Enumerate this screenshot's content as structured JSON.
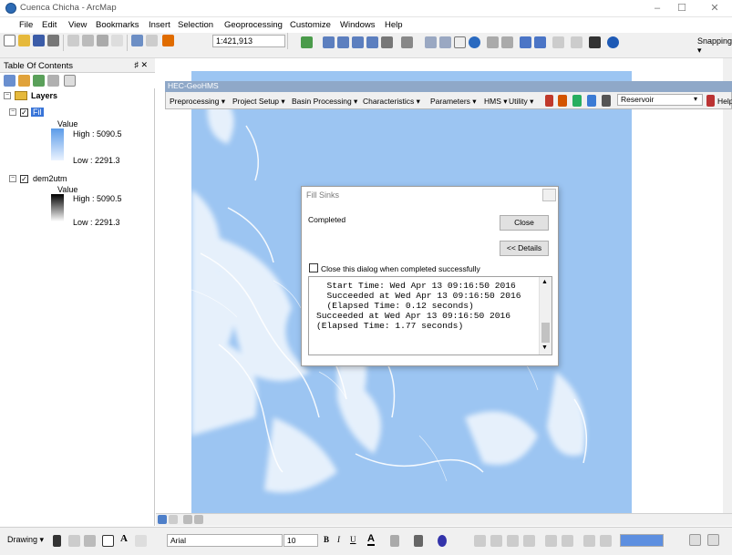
{
  "window": {
    "title": "Cuenca Chicha - ArcMap",
    "minimize": "–",
    "maximize": "☐",
    "close": "✕"
  },
  "menu": [
    "File",
    "Edit",
    "View",
    "Bookmarks",
    "Insert",
    "Selection",
    "Geoprocessing",
    "Customize",
    "Windows",
    "Help"
  ],
  "toolbar": {
    "scale": "1:421,913",
    "snapping": "Snapping ▾"
  },
  "toc": {
    "title": "Table Of Contents",
    "pin": "♯ ✕",
    "root": "Layers",
    "layers": [
      {
        "name": "Fil",
        "value_label": "Value",
        "high": "High : 5090.5",
        "low": "Low : 2291.3",
        "ramp": [
          "#5b9be8",
          "#eaf3ff"
        ]
      },
      {
        "name": "dem2utm",
        "value_label": "Value",
        "high": "High : 5090.5",
        "low": "Low : 2291.3",
        "ramp": [
          "#000000",
          "#ffffff"
        ]
      }
    ]
  },
  "hec": {
    "title": "HEC-GeoHMS",
    "menus": [
      "Preprocessing ▾",
      "Project Setup ▾",
      "Basin Processing ▾",
      "Characteristics ▾",
      "Parameters ▾",
      "HMS ▾",
      "Utility ▾"
    ],
    "dropdown": "Reservoir",
    "help": "Help"
  },
  "dialog": {
    "title": "Fill Sinks",
    "status": "Completed",
    "close_btn": "Close",
    "details_btn": "<< Details",
    "checkbox_label": "Close this dialog when completed successfully",
    "log": "  Start Time: Wed Apr 13 09:16:50 2016\n  Succeeded at Wed Apr 13 09:16:50 2016\n  (Elapsed Time: 0.12 seconds)\nSucceeded at Wed Apr 13 09:16:50 2016\n(Elapsed Time: 1.77 seconds)"
  },
  "drawing": {
    "label": "Drawing ▾",
    "font": "Arial",
    "size": "10",
    "bold": "B",
    "italic": "I",
    "underline": "U"
  },
  "colors": {
    "raster_base": "#9cc5f2",
    "raster_light": "#ffffff",
    "hec_title": "#8fa8c8"
  }
}
